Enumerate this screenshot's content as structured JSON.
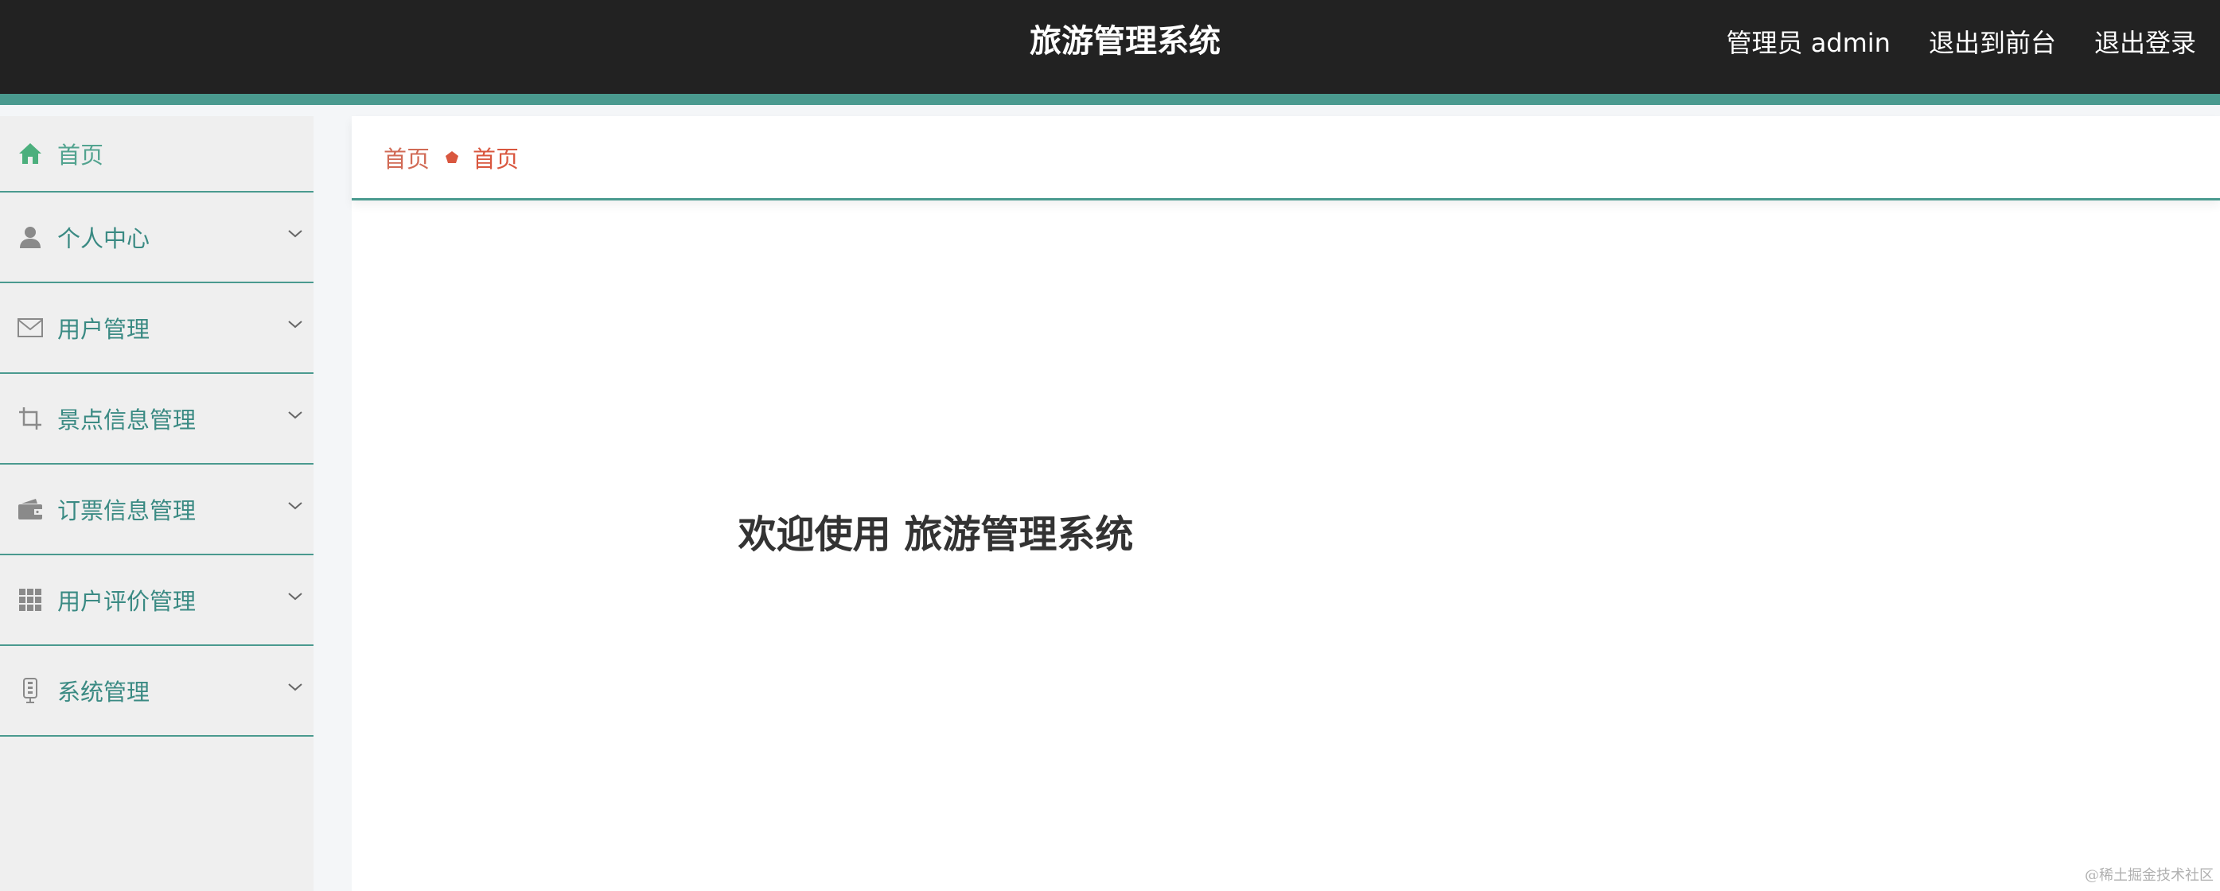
{
  "header": {
    "title": "旅游管理系统",
    "user_label": "管理员 admin",
    "to_frontend": "退出到前台",
    "logout": "退出登录"
  },
  "sidebar": {
    "items": [
      {
        "label": "首页",
        "icon": "home-icon"
      },
      {
        "label": "个人中心",
        "icon": "user-icon"
      },
      {
        "label": "用户管理",
        "icon": "envelope-icon"
      },
      {
        "label": "景点信息管理",
        "icon": "crop-icon"
      },
      {
        "label": "订票信息管理",
        "icon": "wallet-icon"
      },
      {
        "label": "用户评价管理",
        "icon": "grid-icon"
      },
      {
        "label": "系统管理",
        "icon": "device-icon"
      }
    ]
  },
  "breadcrumb": {
    "items": [
      "首页",
      "首页"
    ]
  },
  "main": {
    "welcome": "欢迎使用 旅游管理系统"
  },
  "watermark": "@稀土掘金技术社区",
  "colors": {
    "header_bg": "#222222",
    "accent": "#4a9a8f",
    "menu_text": "#3a8a83",
    "breadcrumb_text": "#d9573f",
    "sidebar_bg": "#efefef"
  }
}
